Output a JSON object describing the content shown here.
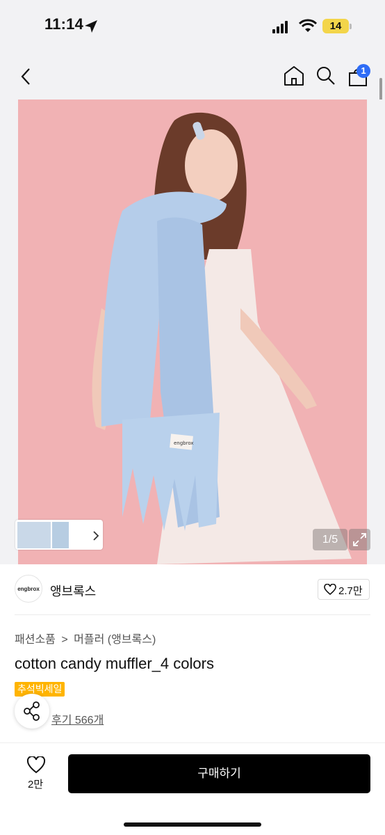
{
  "status_bar": {
    "time": "11:14",
    "battery": "14"
  },
  "nav": {
    "cart_badge": "1"
  },
  "gallery": {
    "counter": "1/5",
    "brand_label_on_scarf": "engbrox"
  },
  "brand": {
    "logo_text": "engbrox",
    "name": "앵브록스",
    "likes": "2.7만"
  },
  "breadcrumb": {
    "level1": "패션소품",
    "separator": ">",
    "level2": "머플러 (앵브록스)"
  },
  "product": {
    "title": "cotton candy muffler_4 colors",
    "sale_tag": "추석빅세일",
    "reviews": "후기 566개"
  },
  "bottom_bar": {
    "wish_count": "2만",
    "buy_label": "구매하기"
  },
  "colors": {
    "cart_badge": "#2e6cf6",
    "sale_tag": "#ffb400",
    "buy_button": "#000000",
    "photo_bg": "#f1b2b4",
    "scarf": "#b5cdea"
  }
}
